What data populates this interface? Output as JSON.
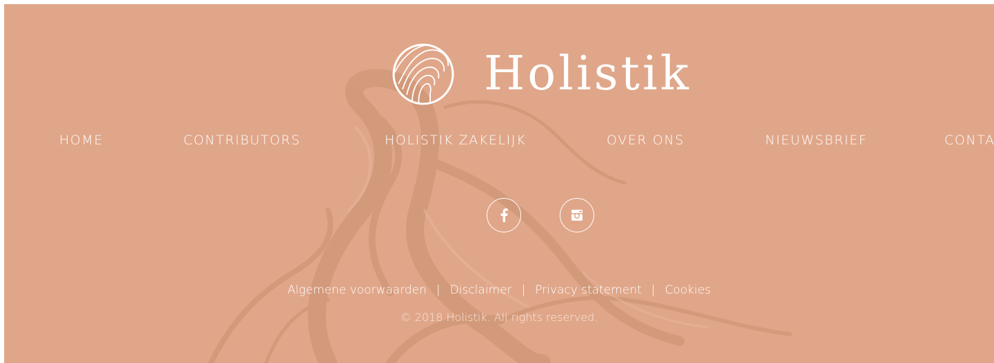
{
  "brand": {
    "name": "Holistik",
    "logo_icon": "wood-rings-logo-icon"
  },
  "nav": {
    "items": [
      {
        "label": "HOME"
      },
      {
        "label": "CONTRIBUTORS"
      },
      {
        "label": "HOLISTIK ZAKELIJK"
      },
      {
        "label": "OVER ONS"
      },
      {
        "label": "NIEUWSBRIEF"
      },
      {
        "label": "CONTA"
      }
    ]
  },
  "social": {
    "facebook_label": "f",
    "facebook_icon": "facebook-icon",
    "instagram_icon": "instagram-icon"
  },
  "legal": {
    "links": [
      {
        "label": "Algemene voorwaarden"
      },
      {
        "label": "Disclaimer"
      },
      {
        "label": "Privacy statement"
      },
      {
        "label": "Cookies"
      }
    ],
    "separator": "|"
  },
  "copyright": "© 2018 Holistik. All rights reserved.",
  "colors": {
    "background": "#e0a689",
    "text": "#ffffff",
    "marble": "#c98e70"
  }
}
